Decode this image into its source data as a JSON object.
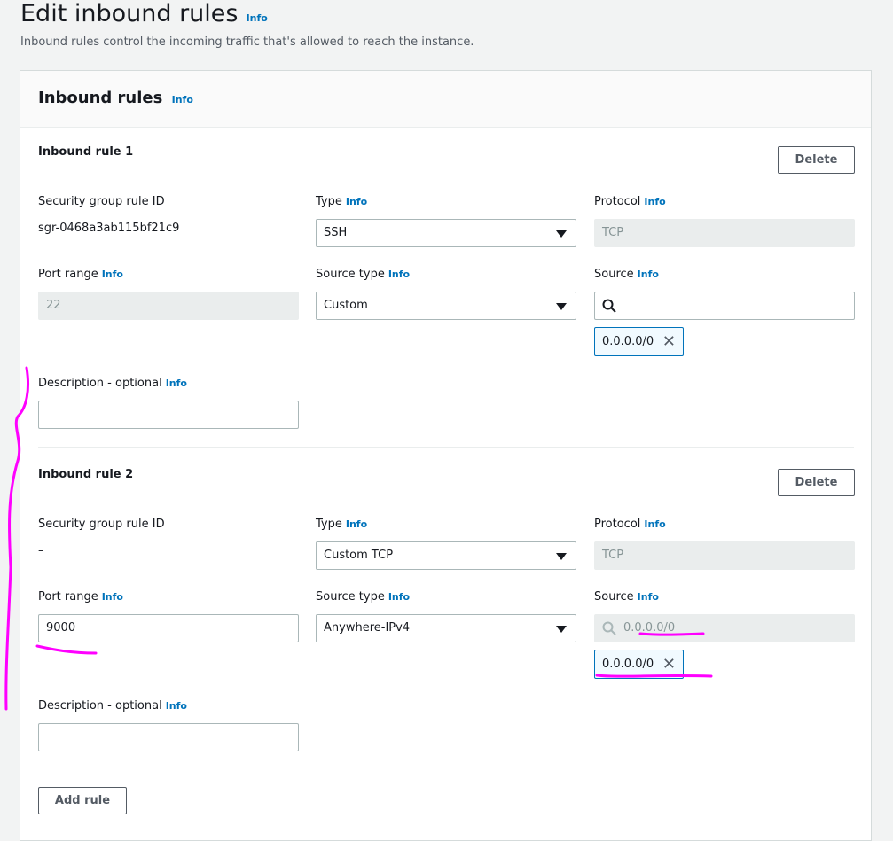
{
  "page": {
    "title": "Edit inbound rules",
    "info": "Info",
    "description": "Inbound rules control the incoming traffic that's allowed to reach the instance."
  },
  "panel": {
    "title": "Inbound rules",
    "info": "Info"
  },
  "labels": {
    "sg_rule_id": "Security group rule ID",
    "type": "Type",
    "protocol": "Protocol",
    "port_range": "Port range",
    "source_type": "Source type",
    "source": "Source",
    "description": "Description - optional",
    "info": "Info",
    "delete": "Delete"
  },
  "rules": [
    {
      "title": "Inbound rule 1",
      "sg_rule_id": "sgr-0468a3ab115bf21c9",
      "type": "SSH",
      "protocol": "TCP",
      "port_range": "22",
      "source_type": "Custom",
      "source_search": "",
      "source_token": "0.0.0.0/0",
      "description": ""
    },
    {
      "title": "Inbound rule 2",
      "sg_rule_id": "–",
      "type": "Custom TCP",
      "protocol": "TCP",
      "port_range": "9000",
      "source_type": "Anywhere-IPv4",
      "source_search": "0.0.0.0/0",
      "source_token": "0.0.0.0/0",
      "description": ""
    }
  ],
  "footer": {
    "add_rule": "Add rule"
  },
  "colors": {
    "link": "#0073bb",
    "annotation": "#ff00ff"
  }
}
